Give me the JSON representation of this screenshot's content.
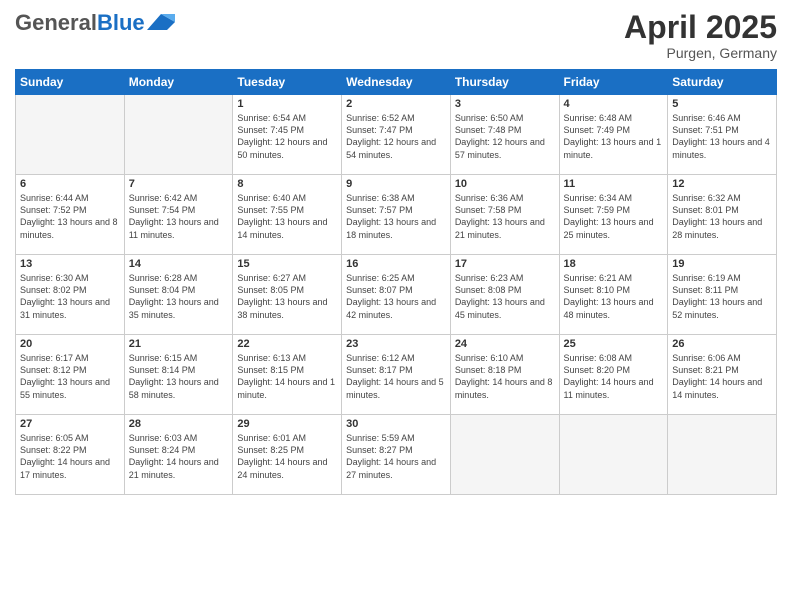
{
  "header": {
    "logo_general": "General",
    "logo_blue": "Blue",
    "month_title": "April 2025",
    "location": "Purgen, Germany"
  },
  "days_of_week": [
    "Sunday",
    "Monday",
    "Tuesday",
    "Wednesday",
    "Thursday",
    "Friday",
    "Saturday"
  ],
  "weeks": [
    [
      {
        "day": "",
        "info": ""
      },
      {
        "day": "",
        "info": ""
      },
      {
        "day": "1",
        "info": "Sunrise: 6:54 AM\nSunset: 7:45 PM\nDaylight: 12 hours and 50 minutes."
      },
      {
        "day": "2",
        "info": "Sunrise: 6:52 AM\nSunset: 7:47 PM\nDaylight: 12 hours and 54 minutes."
      },
      {
        "day": "3",
        "info": "Sunrise: 6:50 AM\nSunset: 7:48 PM\nDaylight: 12 hours and 57 minutes."
      },
      {
        "day": "4",
        "info": "Sunrise: 6:48 AM\nSunset: 7:49 PM\nDaylight: 13 hours and 1 minute."
      },
      {
        "day": "5",
        "info": "Sunrise: 6:46 AM\nSunset: 7:51 PM\nDaylight: 13 hours and 4 minutes."
      }
    ],
    [
      {
        "day": "6",
        "info": "Sunrise: 6:44 AM\nSunset: 7:52 PM\nDaylight: 13 hours and 8 minutes."
      },
      {
        "day": "7",
        "info": "Sunrise: 6:42 AM\nSunset: 7:54 PM\nDaylight: 13 hours and 11 minutes."
      },
      {
        "day": "8",
        "info": "Sunrise: 6:40 AM\nSunset: 7:55 PM\nDaylight: 13 hours and 14 minutes."
      },
      {
        "day": "9",
        "info": "Sunrise: 6:38 AM\nSunset: 7:57 PM\nDaylight: 13 hours and 18 minutes."
      },
      {
        "day": "10",
        "info": "Sunrise: 6:36 AM\nSunset: 7:58 PM\nDaylight: 13 hours and 21 minutes."
      },
      {
        "day": "11",
        "info": "Sunrise: 6:34 AM\nSunset: 7:59 PM\nDaylight: 13 hours and 25 minutes."
      },
      {
        "day": "12",
        "info": "Sunrise: 6:32 AM\nSunset: 8:01 PM\nDaylight: 13 hours and 28 minutes."
      }
    ],
    [
      {
        "day": "13",
        "info": "Sunrise: 6:30 AM\nSunset: 8:02 PM\nDaylight: 13 hours and 31 minutes."
      },
      {
        "day": "14",
        "info": "Sunrise: 6:28 AM\nSunset: 8:04 PM\nDaylight: 13 hours and 35 minutes."
      },
      {
        "day": "15",
        "info": "Sunrise: 6:27 AM\nSunset: 8:05 PM\nDaylight: 13 hours and 38 minutes."
      },
      {
        "day": "16",
        "info": "Sunrise: 6:25 AM\nSunset: 8:07 PM\nDaylight: 13 hours and 42 minutes."
      },
      {
        "day": "17",
        "info": "Sunrise: 6:23 AM\nSunset: 8:08 PM\nDaylight: 13 hours and 45 minutes."
      },
      {
        "day": "18",
        "info": "Sunrise: 6:21 AM\nSunset: 8:10 PM\nDaylight: 13 hours and 48 minutes."
      },
      {
        "day": "19",
        "info": "Sunrise: 6:19 AM\nSunset: 8:11 PM\nDaylight: 13 hours and 52 minutes."
      }
    ],
    [
      {
        "day": "20",
        "info": "Sunrise: 6:17 AM\nSunset: 8:12 PM\nDaylight: 13 hours and 55 minutes."
      },
      {
        "day": "21",
        "info": "Sunrise: 6:15 AM\nSunset: 8:14 PM\nDaylight: 13 hours and 58 minutes."
      },
      {
        "day": "22",
        "info": "Sunrise: 6:13 AM\nSunset: 8:15 PM\nDaylight: 14 hours and 1 minute."
      },
      {
        "day": "23",
        "info": "Sunrise: 6:12 AM\nSunset: 8:17 PM\nDaylight: 14 hours and 5 minutes."
      },
      {
        "day": "24",
        "info": "Sunrise: 6:10 AM\nSunset: 8:18 PM\nDaylight: 14 hours and 8 minutes."
      },
      {
        "day": "25",
        "info": "Sunrise: 6:08 AM\nSunset: 8:20 PM\nDaylight: 14 hours and 11 minutes."
      },
      {
        "day": "26",
        "info": "Sunrise: 6:06 AM\nSunset: 8:21 PM\nDaylight: 14 hours and 14 minutes."
      }
    ],
    [
      {
        "day": "27",
        "info": "Sunrise: 6:05 AM\nSunset: 8:22 PM\nDaylight: 14 hours and 17 minutes."
      },
      {
        "day": "28",
        "info": "Sunrise: 6:03 AM\nSunset: 8:24 PM\nDaylight: 14 hours and 21 minutes."
      },
      {
        "day": "29",
        "info": "Sunrise: 6:01 AM\nSunset: 8:25 PM\nDaylight: 14 hours and 24 minutes."
      },
      {
        "day": "30",
        "info": "Sunrise: 5:59 AM\nSunset: 8:27 PM\nDaylight: 14 hours and 27 minutes."
      },
      {
        "day": "",
        "info": ""
      },
      {
        "day": "",
        "info": ""
      },
      {
        "day": "",
        "info": ""
      }
    ]
  ]
}
